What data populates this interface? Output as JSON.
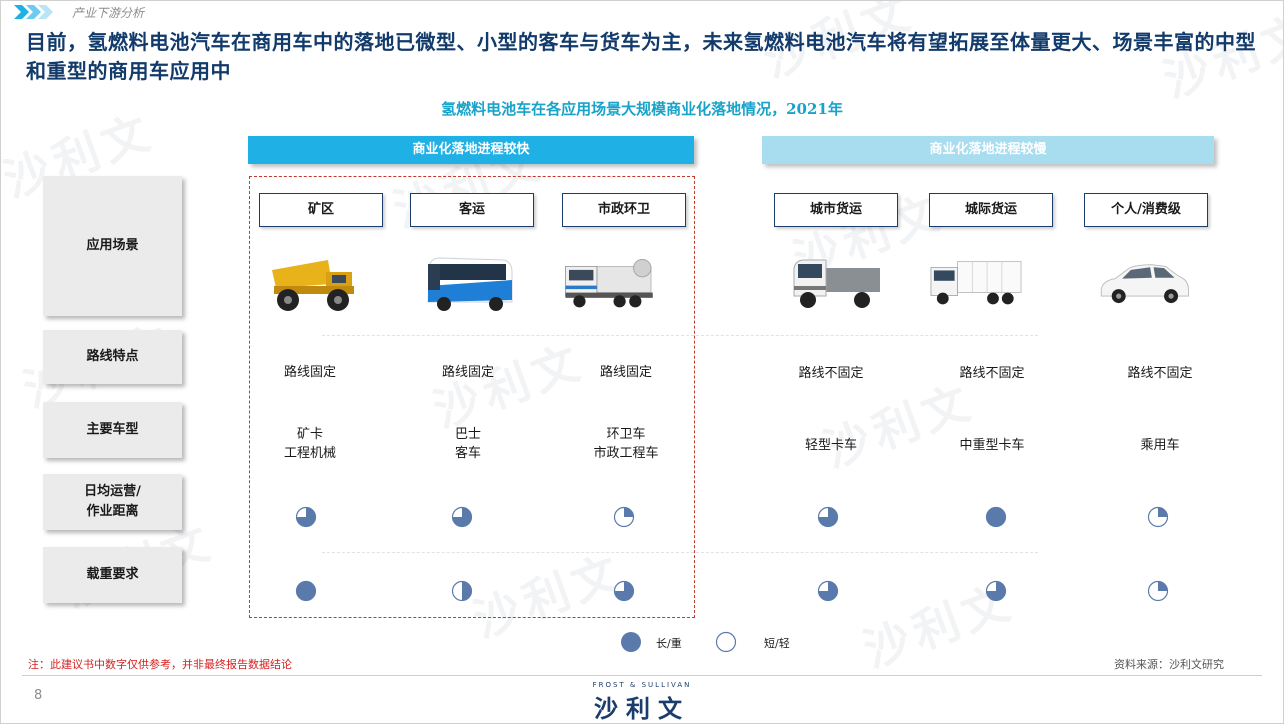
{
  "header": {
    "section_label": "产业下游分析",
    "headline": "目前，氢燃料电池汽车在商用车中的落地已微型、小型的客车与货车为主，未来氢燃料电池汽车将有望拓展至体量更大、场景丰富的中型和重型的商用车应用中"
  },
  "chart_title": "氢燃料电池车在各应用场景大规模商业化落地情况，2021年",
  "banners": {
    "fast": "商业化落地进程较快",
    "slow": "商业化落地进程较慢"
  },
  "row_labels": {
    "scene": "应用场景",
    "route": "路线特点",
    "vehicle_type": "主要车型",
    "distance_line1": "日均运营/",
    "distance_line2": "作业距离",
    "load": "载重要求"
  },
  "scenarios": [
    {
      "name": "矿区",
      "route": "路线固定",
      "type_line1": "矿卡",
      "type_line2": "工程机械",
      "distance_fill": 0.75,
      "load_fill": 1.0,
      "vehicle_icon": "mining-truck-icon"
    },
    {
      "name": "客运",
      "route": "路线固定",
      "type_line1": "巴士",
      "type_line2": "客车",
      "distance_fill": 0.75,
      "load_fill": 0.5,
      "vehicle_icon": "bus-icon"
    },
    {
      "name": "市政环卫",
      "route": "路线固定",
      "type_line1": "环卫车",
      "type_line2": "市政工程车",
      "distance_fill": 0.25,
      "load_fill": 0.75,
      "vehicle_icon": "sanitation-truck-icon"
    },
    {
      "name": "城市货运",
      "route": "路线不固定",
      "type_line1": "",
      "type_line2": "轻型卡车",
      "distance_fill": 0.75,
      "load_fill": 0.75,
      "vehicle_icon": "light-truck-icon"
    },
    {
      "name": "城际货运",
      "route": "路线不固定",
      "type_line1": "",
      "type_line2": "中重型卡车",
      "distance_fill": 1.0,
      "load_fill": 0.75,
      "vehicle_icon": "box-truck-icon"
    },
    {
      "name": "个人/消费级",
      "route": "路线不固定",
      "type_line1": "",
      "type_line2": "乘用车",
      "distance_fill": 0.25,
      "load_fill": 0.25,
      "vehicle_icon": "sedan-icon"
    }
  ],
  "legend": {
    "full_label": "长/重",
    "empty_label": "短/轻"
  },
  "footer": {
    "note": "注：此建议书中数字仅供参考，并非最终报告数据结论",
    "source": "资料来源：沙利文研究",
    "page_number": "8",
    "logo_en": "FROST & SULLIVAN",
    "logo_cn": "沙利文"
  },
  "watermark": "沙利文",
  "colors": {
    "accent_blue": "#1fb0e6",
    "light_blue": "#a8ddf0",
    "title_navy": "#123a6b",
    "circle_fill": "#5b7aac",
    "note_red": "#d62020"
  }
}
